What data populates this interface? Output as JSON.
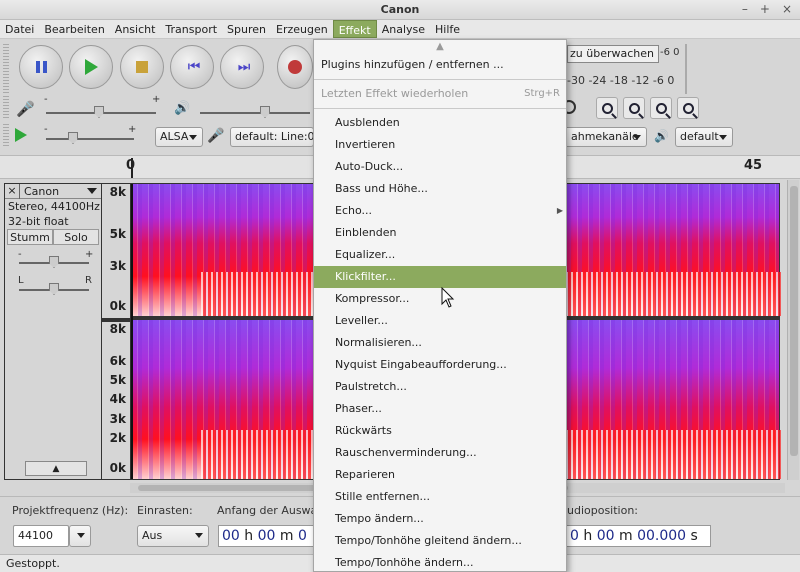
{
  "window": {
    "title": "Canon",
    "buttons": [
      "–",
      "+",
      "×"
    ]
  },
  "menubar": [
    "Datei",
    "Bearbeiten",
    "Ansicht",
    "Transport",
    "Spuren",
    "Erzeugen",
    "Effekt",
    "Analyse",
    "Hilfe"
  ],
  "toolbar": {
    "meter_text": "zu überwachen",
    "meter_scale_top": "-6   0",
    "meter_scale_bottom": "-30 -24 -18 -12 -6   0",
    "host_label": "ALSA",
    "recording_device": "default: Line:0",
    "channels_label": "ahmekanäle",
    "playback_device": "default",
    "rec_slider_minus": "-",
    "rec_slider_plus": "+"
  },
  "timeline": {
    "label_0": "0",
    "label_45": "45"
  },
  "track": {
    "name": "Canon",
    "info1": "Stereo, 44100Hz",
    "info2": "32-bit float",
    "mute_label": "Stumm",
    "solo_label": "Solo",
    "gain_minus": "-",
    "gain_plus": "+",
    "pan_left": "L",
    "pan_right": "R",
    "axis_top": [
      "8k",
      "5k",
      "3k",
      "0k"
    ],
    "axis_bottom": [
      "8k",
      "6k",
      "5k",
      "4k",
      "3k",
      "2k",
      "0k"
    ]
  },
  "selectionbar": {
    "project_rate_label": "Projektfrequenz (Hz):",
    "project_rate_value": "44100",
    "snap_label": "Einrasten:",
    "snap_value": "Aus",
    "selection_start_label": "Anfang der Auswah",
    "start_time": [
      "00",
      "h",
      "00",
      "m",
      "0"
    ],
    "audio_position_label": "udioposition:",
    "position_time": [
      "0",
      "h",
      "00",
      "m",
      "00.000",
      "s"
    ]
  },
  "status": "Gestoppt.",
  "effect_menu": {
    "scroll_indicator": "▲",
    "items_top": [
      {
        "label": "Plugins hinzufügen / entfernen ...",
        "enabled": true
      }
    ],
    "repeat_item": {
      "label": "Letzten Effekt wiederholen",
      "shortcut": "Strg+R"
    },
    "items": [
      {
        "label": "Ausblenden"
      },
      {
        "label": "Invertieren"
      },
      {
        "label": "Auto-Duck..."
      },
      {
        "label": "Bass und Höhe..."
      },
      {
        "label": "Echo...",
        "submenu": true
      },
      {
        "label": "Einblenden"
      },
      {
        "label": "Equalizer..."
      },
      {
        "label": "Klickfilter...",
        "highlighted": true
      },
      {
        "label": "Kompressor..."
      },
      {
        "label": "Leveller..."
      },
      {
        "label": "Normalisieren..."
      },
      {
        "label": "Nyquist Eingabeaufforderung..."
      },
      {
        "label": "Paulstretch..."
      },
      {
        "label": "Phaser..."
      },
      {
        "label": "Rückwärts"
      },
      {
        "label": "Rauschenverminderung..."
      },
      {
        "label": "Reparieren"
      },
      {
        "label": "Stille entfernen..."
      },
      {
        "label": "Tempo ändern..."
      },
      {
        "label": "Tempo/Tonhöhe gleitend ändern..."
      },
      {
        "label": "Tempo/Tonhöhe ändern..."
      }
    ]
  },
  "colors": {
    "accent": "#8caa5e",
    "spectrogram_base": "#c7107a",
    "spectrogram_hot": "#ff1020",
    "spectrogram_cool": "#8a4cf0"
  }
}
